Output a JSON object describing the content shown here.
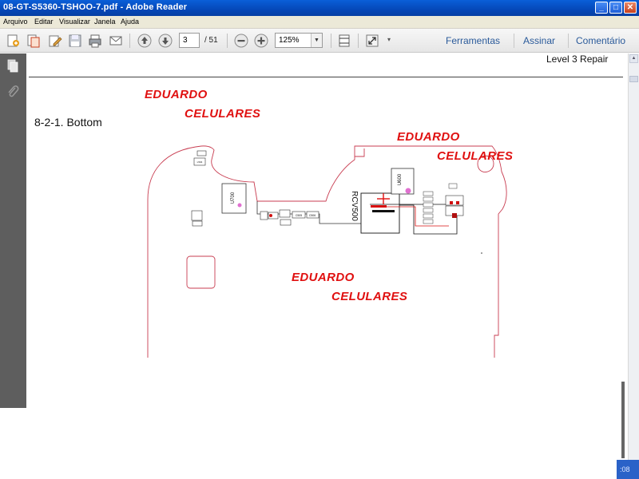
{
  "window": {
    "title": "08-GT-S5360-TSHOO-7.pdf - Adobe Reader"
  },
  "menu": {
    "items": [
      "Arquivo",
      "Editar",
      "Visualizar",
      "Janela",
      "Ajuda"
    ]
  },
  "toolbar": {
    "current_page": "3",
    "total_pages": "/ 51",
    "zoom": "125%",
    "tools_label": "Ferramentas",
    "sign_label": "Assinar",
    "comment_label": "Comentário"
  },
  "document": {
    "header_right": "Level  3  Repair",
    "section_title": "8-2-1.  Bottom",
    "watermarks": [
      "EDUARDO",
      "CELULARES",
      "EDUARDO",
      "CELULARES",
      "EDUARDO",
      "CELULARES"
    ],
    "component_labels": {
      "u700": "U700",
      "rcv500": "RCV500",
      "u600": "U600",
      "c505": "C505",
      "c506": "C506",
      "l504": "L504"
    }
  },
  "taskbar": {
    "clock_fragment": ":08"
  },
  "colors": {
    "watermark": "#e01010",
    "pcb_outline": "#c83c50",
    "nav_panel": "#5e5e5e",
    "titlebar": "#0548b8",
    "link": "#2a5a9a"
  }
}
